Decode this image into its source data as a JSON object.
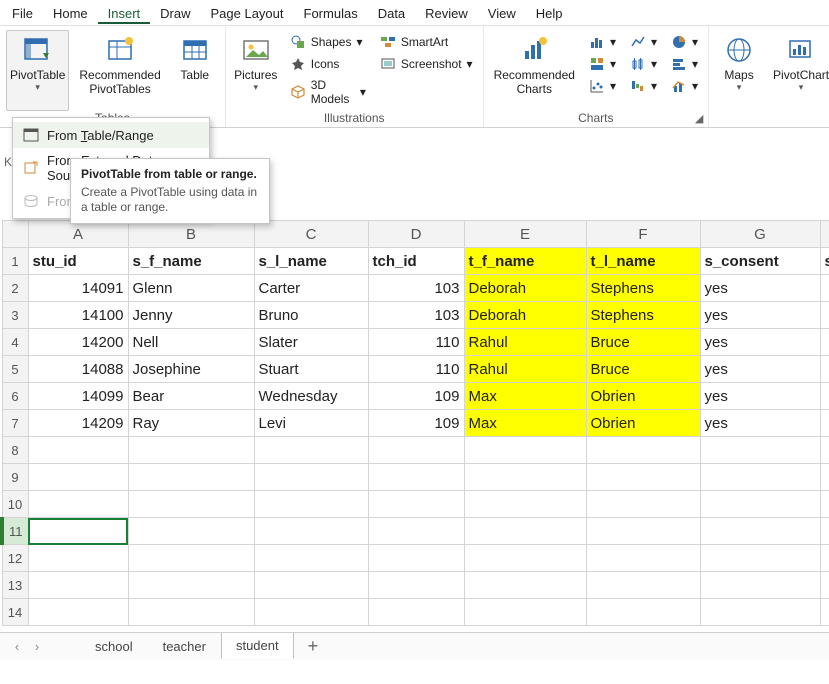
{
  "menubar": [
    "File",
    "Home",
    "Insert",
    "Draw",
    "Page Layout",
    "Formulas",
    "Data",
    "Review",
    "View",
    "Help"
  ],
  "active_menu": "Insert",
  "ribbon": {
    "pivottable": "PivotTable",
    "rec_pivot": "Recommended\nPivotTables",
    "table": "Table",
    "pictures": "Pictures",
    "shapes": "Shapes",
    "icons": "Icons",
    "models3d": "3D Models",
    "smartart": "SmartArt",
    "screenshot": "Screenshot",
    "illustrations": "Illustrations",
    "rec_charts": "Recommended\nCharts",
    "charts": "Charts",
    "maps": "Maps",
    "pivotchart": "PivotChart"
  },
  "dropdown": {
    "from_table": "From Table/Range",
    "from_ext": "From External Data Source",
    "from_dm": "From Data Model"
  },
  "tooltip": {
    "title": "PivotTable from table or range.",
    "desc": "Create a PivotTable using data in a table or range."
  },
  "grid": {
    "columns": [
      "A",
      "B",
      "C",
      "D",
      "E",
      "F",
      "G"
    ],
    "headers": [
      "stu_id",
      "s_f_name",
      "s_l_name",
      "tch_id",
      "t_f_name",
      "t_l_name",
      "s_consent"
    ],
    "yellow_cols": [
      4,
      5
    ],
    "rows": [
      {
        "stu_id": 14091,
        "s_f_name": "Glenn",
        "s_l_name": "Carter",
        "tch_id": 103,
        "t_f_name": "Deborah",
        "t_l_name": "Stephens",
        "s_consent": "yes"
      },
      {
        "stu_id": 14100,
        "s_f_name": "Jenny",
        "s_l_name": "Bruno",
        "tch_id": 103,
        "t_f_name": "Deborah",
        "t_l_name": "Stephens",
        "s_consent": "yes"
      },
      {
        "stu_id": 14200,
        "s_f_name": "Nell",
        "s_l_name": "Slater",
        "tch_id": 110,
        "t_f_name": "Rahul",
        "t_l_name": "Bruce",
        "s_consent": "yes"
      },
      {
        "stu_id": 14088,
        "s_f_name": "Josephine",
        "s_l_name": "Stuart",
        "tch_id": 110,
        "t_f_name": "Rahul",
        "t_l_name": "Bruce",
        "s_consent": "yes"
      },
      {
        "stu_id": 14099,
        "s_f_name": "Bear",
        "s_l_name": "Wednesday",
        "tch_id": 109,
        "t_f_name": "Max",
        "t_l_name": "Obrien",
        "s_consent": "yes"
      },
      {
        "stu_id": 14209,
        "s_f_name": "Ray",
        "s_l_name": "Levi",
        "tch_id": 109,
        "t_f_name": "Max",
        "t_l_name": "Obrien",
        "s_consent": "yes"
      }
    ],
    "total_rows": 14,
    "selected_row": 11,
    "overflow_col": "s"
  },
  "tabs": {
    "items": [
      "school",
      "teacher",
      "student"
    ],
    "active": "student"
  }
}
